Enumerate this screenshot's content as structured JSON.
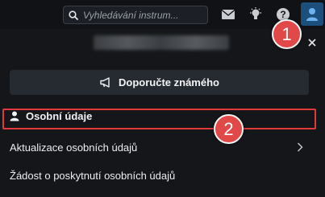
{
  "topbar": {
    "search_placeholder": "Vyhledávání instrum...",
    "icons": [
      "search-icon",
      "mail-icon",
      "lightbulb-icon",
      "help-icon",
      "user-icon"
    ],
    "help_glyph": "?"
  },
  "panel": {
    "recommend_label": "Doporučte známého",
    "section_title": "Osobní údaje",
    "items": [
      {
        "label": "Aktualizace osobních údajů"
      },
      {
        "label": "Žádost o poskytnutí osobních údajů"
      }
    ]
  },
  "annotations": {
    "badge1": "1",
    "badge2": "2",
    "highlight_color": "#e03a3a"
  },
  "colors": {
    "accent": "#1d4f7d",
    "panel_bg": "#141619",
    "button_bg": "#262b32"
  }
}
